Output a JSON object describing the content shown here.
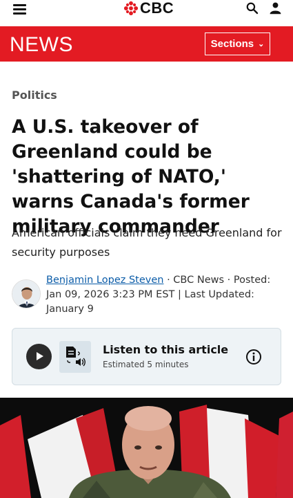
{
  "header": {
    "logo_text": "CBC",
    "menu_icon": "hamburger-menu-icon",
    "search_icon": "search-icon",
    "account_icon": "account-icon"
  },
  "newsbar": {
    "section_title": "NEWS",
    "sections_label": "Sections",
    "accent_color": "#e31b23"
  },
  "article": {
    "category": "Politics",
    "headline": "A U.S. takeover of Greenland could be 'shattering of NATO,' warns Canada's former military commander",
    "subheadline": "American officials claim they need Greenland for security purposes",
    "author": "Benjamin Lopez Steven",
    "outlet_sep": " · CBC News · ",
    "posted": "Posted: Jan 09, 2026 3:23 PM EST | Last Updated: January 9"
  },
  "audio": {
    "title": "Listen to this article",
    "subtitle": "Estimated 5 minutes"
  }
}
